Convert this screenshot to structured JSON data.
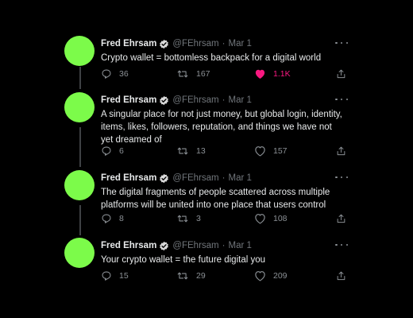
{
  "colors": {
    "background": "#000000",
    "avatar": "#7cfb4a",
    "verified_badge": "#d9d9d9",
    "like_active": "#f91880",
    "muted_text": "#71767b"
  },
  "author": {
    "name": "Fred Ehrsam",
    "handle": "@FEhrsam",
    "separator": "·",
    "verified": true
  },
  "tweets": [
    {
      "date": "Mar 1",
      "text": "Crypto wallet = bottomless backpack for a digital world",
      "replies": "36",
      "retweets": "167",
      "likes": "1.1K",
      "liked": true
    },
    {
      "date": "Mar 1",
      "text": "A singular place for not just money, but global login, identity, items, likes, followers, reputation, and things we have not yet dreamed of",
      "replies": "6",
      "retweets": "13",
      "likes": "157",
      "liked": false
    },
    {
      "date": "Mar 1",
      "text": "The digital fragments of people scattered across multiple platforms will be united into one place that users control",
      "replies": "8",
      "retweets": "3",
      "likes": "108",
      "liked": false
    },
    {
      "date": "Mar 1",
      "text": "Your crypto wallet = the future digital you",
      "replies": "15",
      "retweets": "29",
      "likes": "209",
      "liked": false
    }
  ],
  "icons": {
    "avatar": "profile-avatar",
    "verified": "verified-badge-icon",
    "more": "more-options-icon",
    "reply": "reply-icon",
    "retweet": "retweet-icon",
    "like": "heart-icon",
    "share": "share-icon"
  }
}
